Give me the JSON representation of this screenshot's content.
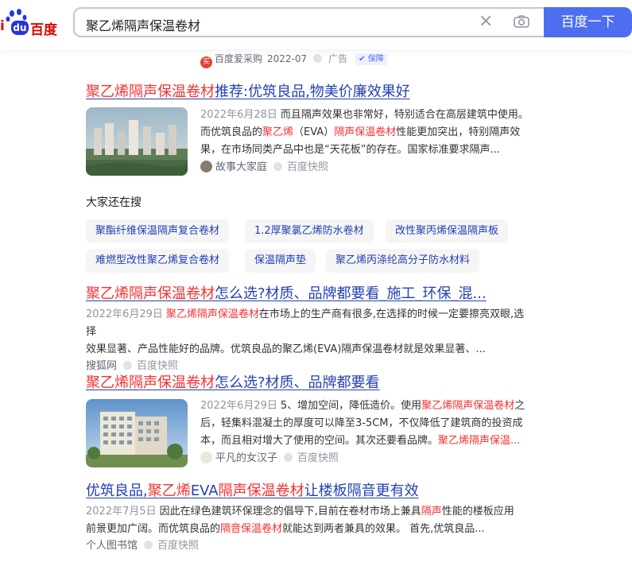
{
  "header": {
    "logo_text_left": "i",
    "logo_du": "du",
    "logo_text_right": "百度",
    "query": "聚乙烯隔声保温卷材",
    "clear_icon": "close-icon",
    "camera_icon": "camera-icon",
    "search_button": "百度一下"
  },
  "ad_line": {
    "source": "百度爱采购",
    "date": "2022-07",
    "ad_label": "广告",
    "guard_label": "保障"
  },
  "results": [
    {
      "title_hl": "聚乙烯隔声保温卷材",
      "title_rest": "推荐:优筑良品,物美价廉效果好",
      "date": "2022年6月28日",
      "snippet_lines": [
        {
          "parts": [
            {
              "t": "而且隔声效果也非常好，特别适合在高层建筑中使用。",
              "hl": false
            }
          ]
        },
        {
          "parts": [
            {
              "t": "而优筑良品的",
              "hl": false
            },
            {
              "t": "聚乙烯",
              "hl": true
            },
            {
              "t": "（EVA）",
              "hl": false
            },
            {
              "t": "隔声保温卷材",
              "hl": true
            },
            {
              "t": "性能更加突出，特别隔声效",
              "hl": false
            }
          ]
        },
        {
          "parts": [
            {
              "t": "果，在市场同类产品中也是“天花板”的存在。国家标准要求隔声...",
              "hl": false
            }
          ]
        }
      ],
      "source": "故事大家庭",
      "kuaizhao": "百度快照"
    },
    {
      "title_hl": "聚乙烯隔声保温卷材",
      "title_rest": "怎么选?材质、品牌都要看_施工_环保_混...",
      "date": "2022年6月29日",
      "snippet_lines": [
        {
          "parts": [
            {
              "t": "聚乙烯隔声保温卷材",
              "hl": true
            },
            {
              "t": "在市场上的生产商有很多,在选择的时候一定要擦亮双眼,选择",
              "hl": false
            }
          ]
        },
        {
          "parts": [
            {
              "t": "效果显著、产品性能好的品牌。优筑良品的聚乙烯(EVA)隔声保温卷材就是效果显著、...",
              "hl": false
            }
          ]
        }
      ],
      "source": "搜狐网",
      "kuaizhao": "百度快照"
    },
    {
      "title_hl": "聚乙烯隔声保温卷材",
      "title_rest": "怎么选?材质、品牌都要看",
      "date": "2022年6月29日",
      "snippet_lines": [
        {
          "parts": [
            {
              "t": "5、增加空间，降低造价。使用",
              "hl": false
            },
            {
              "t": "聚乙烯隔声保温卷材",
              "hl": true
            },
            {
              "t": "之",
              "hl": false
            }
          ]
        },
        {
          "parts": [
            {
              "t": "后，轻集料混凝土的厚度可以降至3-5CM，不仅降低了建筑商的投资成",
              "hl": false
            }
          ]
        },
        {
          "parts": [
            {
              "t": "本，而且相对增大了使用的空间。其次还要看品牌。",
              "hl": false
            },
            {
              "t": "聚乙烯隔声保温...",
              "hl": true
            }
          ]
        }
      ],
      "source": "平凡的女汉子",
      "kuaizhao": "百度快照"
    },
    {
      "title_parts": [
        {
          "t": "优筑良品,",
          "hl": false
        },
        {
          "t": "聚乙烯",
          "hl": true
        },
        {
          "t": "EVA",
          "hl": false
        },
        {
          "t": "隔声保温卷材",
          "hl": true
        },
        {
          "t": "让楼板隔音更有效",
          "hl": false
        }
      ],
      "date": "2022年7月5日",
      "snippet_lines": [
        {
          "parts": [
            {
              "t": "因此在绿色建筑环保理念的倡导下,目前在卷材市场上兼具",
              "hl": false
            },
            {
              "t": "隔声",
              "hl": true
            },
            {
              "t": "性能的楼板应用",
              "hl": false
            }
          ]
        },
        {
          "parts": [
            {
              "t": "前景更加广阔。而优筑良品的",
              "hl": false
            },
            {
              "t": "隔音保温卷材",
              "hl": true
            },
            {
              "t": "就能达到两者兼具的效果。 首先,优筑良品...",
              "hl": false
            }
          ]
        }
      ],
      "source": "个人图书馆",
      "kuaizhao": "百度快照"
    }
  ],
  "also_search": {
    "title": "大家还在搜",
    "chips": [
      "聚酯纤维保温隔声复合卷材",
      "1.2厚聚氯乙烯防水卷材",
      "改性聚丙烯保温隔声板",
      "难燃型改性聚乙烯复合卷材",
      "保温隔声垫",
      "聚乙烯丙涤纶高分子防水材料"
    ]
  },
  "colors": {
    "brand_blue": "#4e6ef2",
    "link_blue": "#2440b3",
    "highlight_red": "#f73131",
    "logo_red": "#e10601"
  }
}
